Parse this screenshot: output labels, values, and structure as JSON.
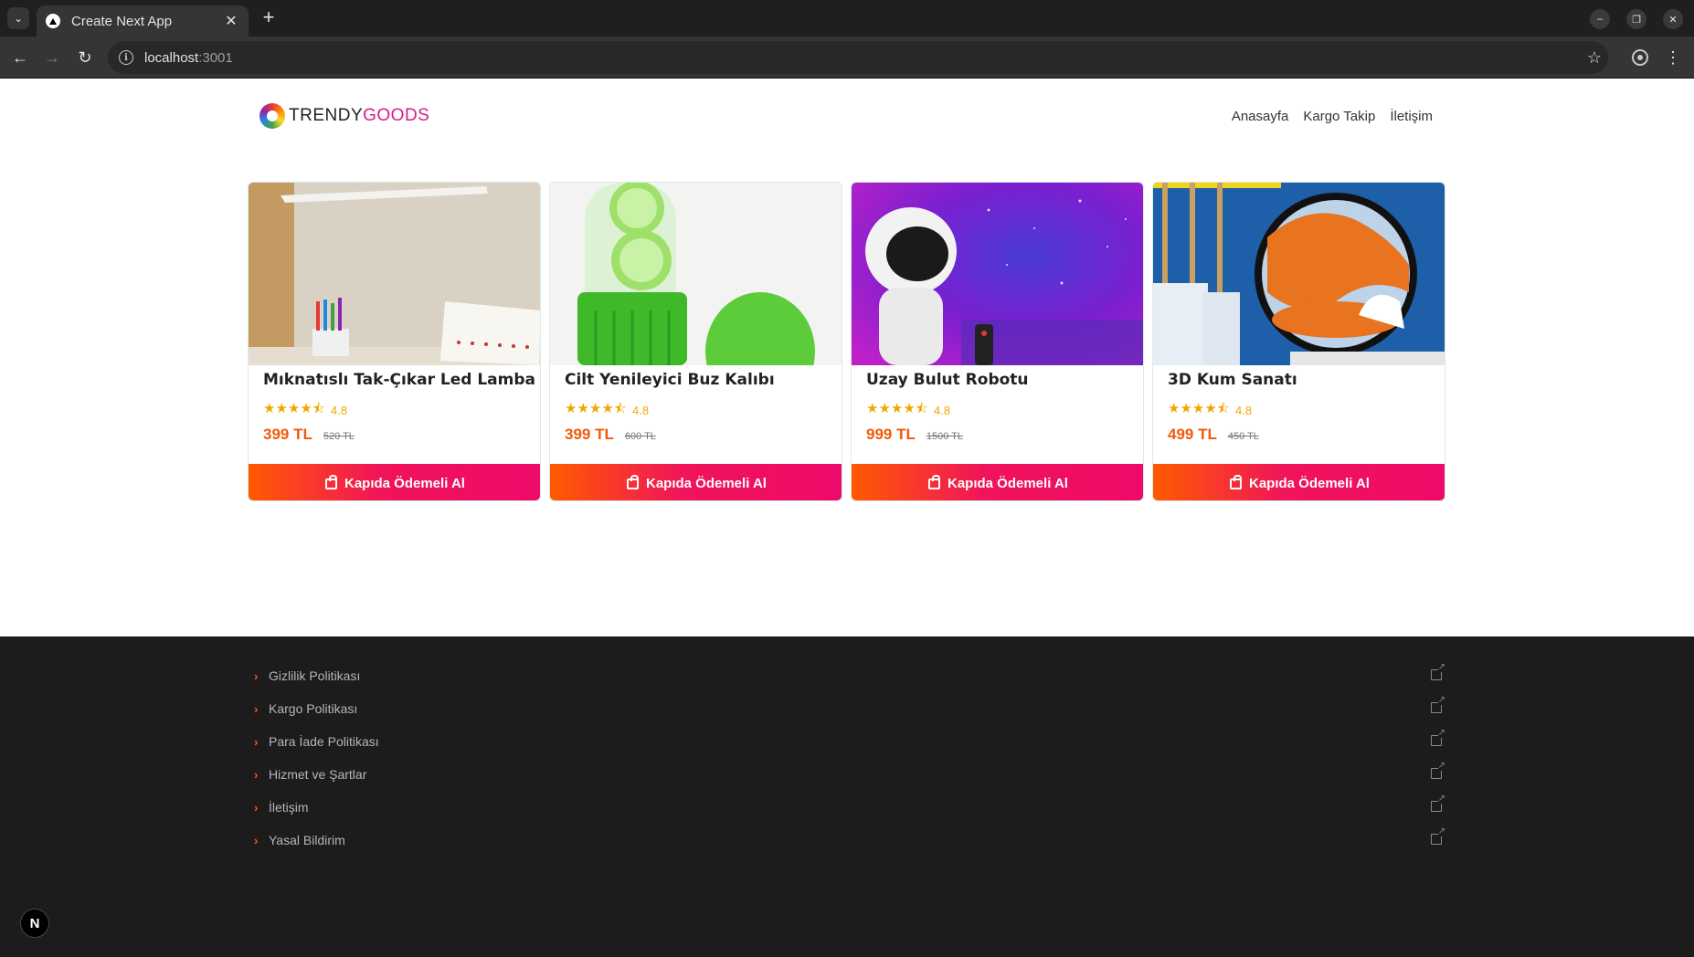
{
  "browser": {
    "tab_title": "Create Next App",
    "url_host": "localhost",
    "url_port": ":3001",
    "tab_close": "✕",
    "new_tab": "+",
    "tab_menu": "⌄",
    "icons": [
      "chevron-down-icon",
      "close-icon",
      "plus-icon",
      "minimize-icon",
      "restore-icon",
      "back-arrow-icon",
      "forward-arrow-icon",
      "reload-icon",
      "info-icon",
      "star-icon",
      "profile-icon",
      "menu-dots-icon"
    ]
  },
  "header": {
    "logo_trendy": "TRENDY",
    "logo_goods": "GOODS",
    "nav": [
      {
        "label": "Anasayfa"
      },
      {
        "label": "Kargo Takip"
      },
      {
        "label": "İletişim"
      }
    ]
  },
  "products": [
    {
      "title": "Mıknatıslı Tak-Çıkar Led Lamba",
      "rating": "4.8",
      "price": "399 TL",
      "old_price": "520 TL",
      "button": "Kapıda Ödemeli Al"
    },
    {
      "title": "Cilt Yenileyici Buz Kalıbı",
      "rating": "4.8",
      "price": "399 TL",
      "old_price": "600 TL",
      "button": "Kapıda Ödemeli Al"
    },
    {
      "title": "Uzay Bulut Robotu",
      "rating": "4.8",
      "price": "999 TL",
      "old_price": "1500 TL",
      "button": "Kapıda Ödemeli Al"
    },
    {
      "title": "3D Kum Sanatı",
      "rating": "4.8",
      "price": "499 TL",
      "old_price": "450 TL",
      "button": "Kapıda Ödemeli Al"
    }
  ],
  "stars": "★★★★⯪",
  "footer": {
    "links": [
      {
        "label": "Gizlilik Politikası"
      },
      {
        "label": "Kargo Politikası"
      },
      {
        "label": "Para İade Politikası"
      },
      {
        "label": "Hizmet ve Şartlar"
      },
      {
        "label": "İletişim"
      },
      {
        "label": "Yasal Bildirim"
      }
    ],
    "next_badge": "N"
  },
  "colors": {
    "accent_orange": "#ff5a00",
    "accent_pink": "#ee0a6a",
    "star": "#f0a800",
    "brand_pink": "#d81b8c",
    "footer_bg": "#1c1c1d"
  }
}
